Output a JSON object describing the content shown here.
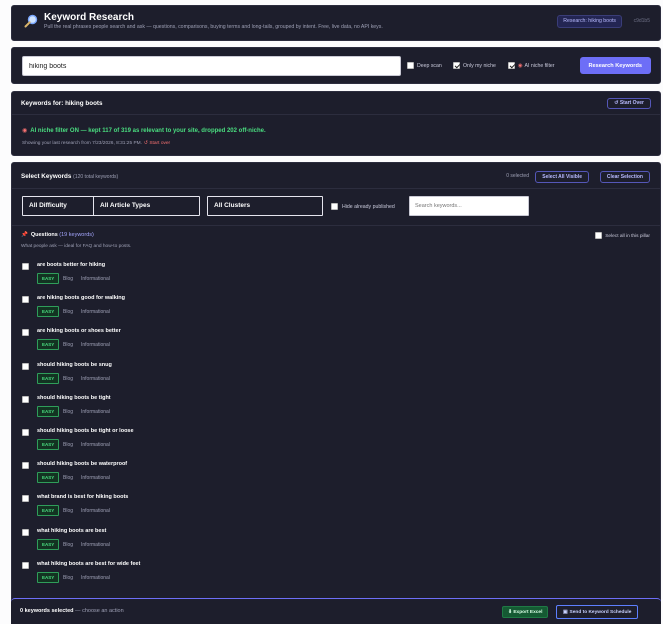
{
  "header": {
    "title": "Keyword Research",
    "subtitle": "Pull the real phrases people search and ask — questions, comparisons, buying terms and long-tails, grouped by intent. Free, live data, no API keys.",
    "badge": "Research: hiking boots",
    "version": "c9d1b5"
  },
  "search": {
    "value": "hiking boots",
    "deep_scan": "Deep scan",
    "only_my_niche": "Only my niche",
    "ai_niche_filter": "AI niche filter",
    "button": "Research Keywords"
  },
  "keywords_for": {
    "title": "Keywords for: hiking boots",
    "start_over_button": "↺ Start Over",
    "filter_message": "AI niche filter ON — kept 117 of 319 as relevant to your site, dropped 202 off-niche.",
    "last_research": "Showing your last research from 7/23/2026, 8:31:25 PM.",
    "start_over_link": "↺ Start over"
  },
  "select": {
    "title": "Select Keywords",
    "total": "(120 total keywords)",
    "selected_count": "0 selected",
    "select_all_button": "Select All Visible",
    "clear_button": "Clear Selection",
    "difficulty_filter": "All Difficulty",
    "article_types_filter": "All Article Types",
    "clusters_filter": "All Clusters",
    "hide_published": "Hide already published",
    "search_placeholder": "Search keywords...",
    "pillar_title": "Questions",
    "pillar_count": "(19 keywords)",
    "pillar_desc": "What people ask — ideal for FAQ and how-to posts.",
    "select_all_pillar": "Select all in this pillar",
    "keywords": [
      {
        "text": "are boots better for hiking",
        "difficulty": "EASY",
        "type": "Blog",
        "intent": "Informational"
      },
      {
        "text": "are hiking boots good for walking",
        "difficulty": "EASY",
        "type": "Blog",
        "intent": "Informational"
      },
      {
        "text": "are hiking boots or shoes better",
        "difficulty": "EASY",
        "type": "Blog",
        "intent": "Informational"
      },
      {
        "text": "should hiking boots be snug",
        "difficulty": "EASY",
        "type": "Blog",
        "intent": "Informational"
      },
      {
        "text": "should hiking boots be tight",
        "difficulty": "EASY",
        "type": "Blog",
        "intent": "Informational"
      },
      {
        "text": "should hiking boots be tight or loose",
        "difficulty": "EASY",
        "type": "Blog",
        "intent": "Informational"
      },
      {
        "text": "should hiking boots be waterproof",
        "difficulty": "EASY",
        "type": "Blog",
        "intent": "Informational"
      },
      {
        "text": "what brand is best for hiking boots",
        "difficulty": "EASY",
        "type": "Blog",
        "intent": "Informational"
      },
      {
        "text": "what hiking boots are best",
        "difficulty": "EASY",
        "type": "Blog",
        "intent": "Informational"
      },
      {
        "text": "what hiking boots are best for wide feet",
        "difficulty": "EASY",
        "type": "Blog",
        "intent": "Informational"
      }
    ]
  },
  "bar": {
    "selected": "0 keywords selected",
    "hint": "— choose an action",
    "export_button": "⬇ Export Excel",
    "schedule_button": "Send to Keyword Schedule"
  }
}
